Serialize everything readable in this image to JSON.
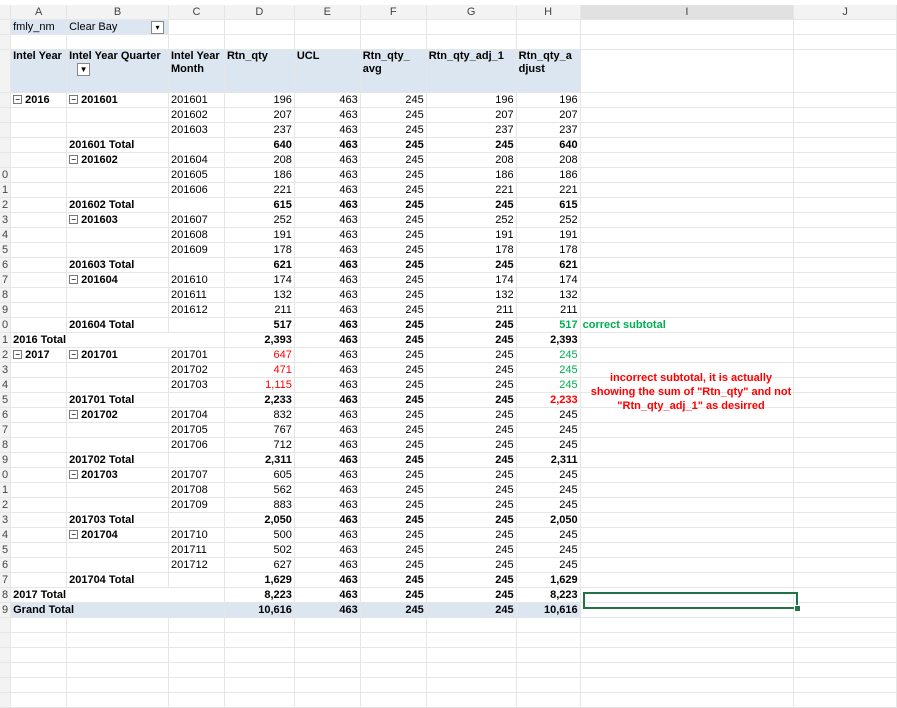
{
  "columns": [
    "A",
    "B",
    "C",
    "D",
    "E",
    "F",
    "G",
    "H",
    "I",
    "J"
  ],
  "filter": {
    "field": "fmly_nm",
    "value": "Clear Bay"
  },
  "headers": {
    "intel_year": "Intel Year",
    "intel_year_quarter": "Intel Year Quarter",
    "intel_year_month": "Intel Year Month",
    "rtn_qty": "Rtn_qty",
    "ucl": "UCL",
    "rtn_qty_avg": "Rtn_qty_ avg",
    "rtn_qty_adj_1": "Rtn_qty_adj_1",
    "rtn_qty_adjust": "Rtn_qty_a djust"
  },
  "row_numbers": [
    "",
    "",
    "",
    "",
    "",
    "",
    "",
    "",
    "",
    "0",
    "1",
    "2",
    "3",
    "4",
    "5",
    "6",
    "7",
    "8",
    "9",
    "0",
    "1",
    "2",
    "3",
    "4",
    "5",
    "6",
    "7",
    "8",
    "9",
    "0",
    "1",
    "2",
    "3",
    "4",
    "5",
    "6",
    "7",
    "8",
    "9",
    "0",
    "1",
    "2",
    "3",
    "4",
    "5"
  ],
  "rows": [
    {
      "type": "data",
      "year": "2016",
      "quarter": "201601",
      "month": "201601",
      "rtn": "196",
      "ucl": "463",
      "avg": "245",
      "adj1": "196",
      "adjust": "196"
    },
    {
      "type": "data",
      "month": "201602",
      "rtn": "207",
      "ucl": "463",
      "avg": "245",
      "adj1": "207",
      "adjust": "207"
    },
    {
      "type": "data",
      "month": "201603",
      "rtn": "237",
      "ucl": "463",
      "avg": "245",
      "adj1": "237",
      "adjust": "237"
    },
    {
      "type": "qtotal",
      "label": "201601 Total",
      "rtn": "640",
      "ucl": "463",
      "avg": "245",
      "adj1": "245",
      "adjust": "640"
    },
    {
      "type": "data",
      "quarter": "201602",
      "month": "201604",
      "rtn": "208",
      "ucl": "463",
      "avg": "245",
      "adj1": "208",
      "adjust": "208"
    },
    {
      "type": "data",
      "month": "201605",
      "rtn": "186",
      "ucl": "463",
      "avg": "245",
      "adj1": "186",
      "adjust": "186"
    },
    {
      "type": "data",
      "month": "201606",
      "rtn": "221",
      "ucl": "463",
      "avg": "245",
      "adj1": "221",
      "adjust": "221"
    },
    {
      "type": "qtotal",
      "label": "201602 Total",
      "rtn": "615",
      "ucl": "463",
      "avg": "245",
      "adj1": "245",
      "adjust": "615"
    },
    {
      "type": "data",
      "quarter": "201603",
      "month": "201607",
      "rtn": "252",
      "ucl": "463",
      "avg": "245",
      "adj1": "252",
      "adjust": "252"
    },
    {
      "type": "data",
      "month": "201608",
      "rtn": "191",
      "ucl": "463",
      "avg": "245",
      "adj1": "191",
      "adjust": "191"
    },
    {
      "type": "data",
      "month": "201609",
      "rtn": "178",
      "ucl": "463",
      "avg": "245",
      "adj1": "178",
      "adjust": "178"
    },
    {
      "type": "qtotal",
      "label": "201603 Total",
      "rtn": "621",
      "ucl": "463",
      "avg": "245",
      "adj1": "245",
      "adjust": "621"
    },
    {
      "type": "data",
      "quarter": "201604",
      "month": "201610",
      "rtn": "174",
      "ucl": "463",
      "avg": "245",
      "adj1": "174",
      "adjust": "174"
    },
    {
      "type": "data",
      "month": "201611",
      "rtn": "132",
      "ucl": "463",
      "avg": "245",
      "adj1": "132",
      "adjust": "132"
    },
    {
      "type": "data",
      "month": "201612",
      "rtn": "211",
      "ucl": "463",
      "avg": "245",
      "adj1": "211",
      "adjust": "211"
    },
    {
      "type": "qtotal",
      "label": "201604 Total",
      "rtn": "517",
      "ucl": "463",
      "avg": "245",
      "adj1": "245",
      "adjust": "517",
      "adjust_color": "green",
      "note": "correct subtotal"
    },
    {
      "type": "ytotal",
      "label": "2016 Total",
      "rtn": "2,393",
      "ucl": "463",
      "avg": "245",
      "adj1": "245",
      "adjust": "2,393"
    },
    {
      "type": "data",
      "year": "2017",
      "quarter": "201701",
      "month": "201701",
      "rtn": "647",
      "rtn_color": "red",
      "ucl": "463",
      "avg": "245",
      "adj1": "245",
      "adjust": "245",
      "adjust_color": "green"
    },
    {
      "type": "data",
      "month": "201702",
      "rtn": "471",
      "rtn_color": "red",
      "ucl": "463",
      "avg": "245",
      "adj1": "245",
      "adjust": "245",
      "adjust_color": "green"
    },
    {
      "type": "data",
      "month": "201703",
      "rtn": "1,115",
      "rtn_color": "red",
      "ucl": "463",
      "avg": "245",
      "adj1": "245",
      "adjust": "245",
      "adjust_color": "green"
    },
    {
      "type": "qtotal",
      "label": "201701 Total",
      "rtn": "2,233",
      "ucl": "463",
      "avg": "245",
      "adj1": "245",
      "adjust": "2,233",
      "adjust_color": "red"
    },
    {
      "type": "data",
      "quarter": "201702",
      "month": "201704",
      "rtn": "832",
      "ucl": "463",
      "avg": "245",
      "adj1": "245",
      "adjust": "245"
    },
    {
      "type": "data",
      "month": "201705",
      "rtn": "767",
      "ucl": "463",
      "avg": "245",
      "adj1": "245",
      "adjust": "245"
    },
    {
      "type": "data",
      "month": "201706",
      "rtn": "712",
      "ucl": "463",
      "avg": "245",
      "adj1": "245",
      "adjust": "245"
    },
    {
      "type": "qtotal",
      "label": "201702 Total",
      "rtn": "2,311",
      "ucl": "463",
      "avg": "245",
      "adj1": "245",
      "adjust": "2,311"
    },
    {
      "type": "data",
      "quarter": "201703",
      "month": "201707",
      "rtn": "605",
      "ucl": "463",
      "avg": "245",
      "adj1": "245",
      "adjust": "245"
    },
    {
      "type": "data",
      "month": "201708",
      "rtn": "562",
      "ucl": "463",
      "avg": "245",
      "adj1": "245",
      "adjust": "245"
    },
    {
      "type": "data",
      "month": "201709",
      "rtn": "883",
      "ucl": "463",
      "avg": "245",
      "adj1": "245",
      "adjust": "245"
    },
    {
      "type": "qtotal",
      "label": "201703 Total",
      "rtn": "2,050",
      "ucl": "463",
      "avg": "245",
      "adj1": "245",
      "adjust": "2,050"
    },
    {
      "type": "data",
      "quarter": "201704",
      "month": "201710",
      "rtn": "500",
      "ucl": "463",
      "avg": "245",
      "adj1": "245",
      "adjust": "245"
    },
    {
      "type": "data",
      "month": "201711",
      "rtn": "502",
      "ucl": "463",
      "avg": "245",
      "adj1": "245",
      "adjust": "245"
    },
    {
      "type": "data",
      "month": "201712",
      "rtn": "627",
      "ucl": "463",
      "avg": "245",
      "adj1": "245",
      "adjust": "245"
    },
    {
      "type": "qtotal",
      "label": "201704 Total",
      "rtn": "1,629",
      "ucl": "463",
      "avg": "245",
      "adj1": "245",
      "adjust": "1,629"
    },
    {
      "type": "ytotal",
      "label": "2017 Total",
      "rtn": "8,223",
      "ucl": "463",
      "avg": "245",
      "adj1": "245",
      "adjust": "8,223"
    },
    {
      "type": "grand",
      "label": "Grand Total",
      "rtn": "10,616",
      "ucl": "463",
      "avg": "245",
      "adj1": "245",
      "adjust": "10,616"
    }
  ],
  "annotations": {
    "incorrect": "incorrect subtotal, it is actually showing the sum of \"Rtn_qty\" and not \"Rtn_qty_adj_1\" as desirred"
  },
  "colors": {
    "header_fill": "#dce6f1",
    "red": "#ff0000",
    "green": "#00b050",
    "selection": "#217346"
  }
}
